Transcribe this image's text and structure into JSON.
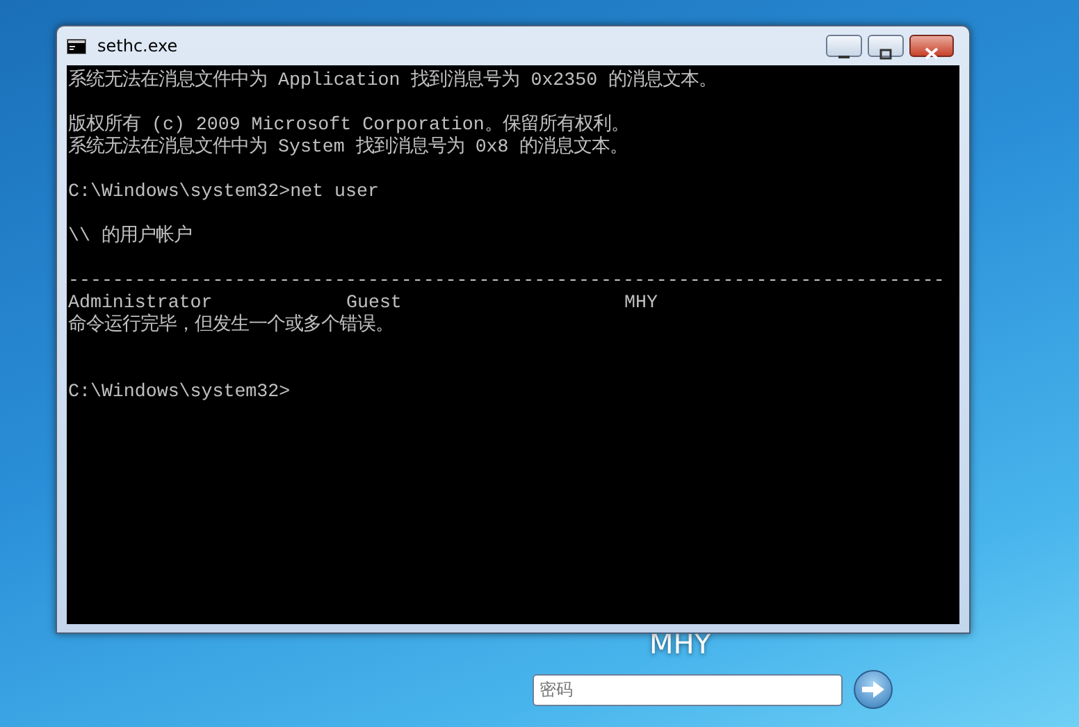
{
  "window": {
    "title": "sethc.exe"
  },
  "console": {
    "lines": [
      {
        "kind": "text",
        "text": "系统无法在消息文件中为 Application 找到消息号为 0x2350 的消息文本。"
      },
      {
        "kind": "blank"
      },
      {
        "kind": "text",
        "text": "版权所有 (c) 2009 Microsoft Corporation。保留所有权利。"
      },
      {
        "kind": "text",
        "text": "系统无法在消息文件中为 System 找到消息号为 0x8 的消息文本。"
      },
      {
        "kind": "blank"
      },
      {
        "kind": "text",
        "text": "C:\\Windows\\system32>net user"
      },
      {
        "kind": "blank"
      },
      {
        "kind": "text",
        "text": "\\\\ 的用户帐户"
      },
      {
        "kind": "blank"
      },
      {
        "kind": "text",
        "text": "-------------------------------------------------------------------------------"
      },
      {
        "kind": "columns",
        "cells": [
          "Administrator",
          "Guest",
          "MHY"
        ]
      },
      {
        "kind": "text",
        "text": "命令运行完毕，但发生一个或多个错误。"
      },
      {
        "kind": "blank"
      },
      {
        "kind": "blank"
      },
      {
        "kind": "text",
        "text": "C:\\Windows\\system32>"
      }
    ]
  },
  "logon": {
    "user_name": "MHY",
    "password": {
      "placeholder": "密码"
    }
  }
}
